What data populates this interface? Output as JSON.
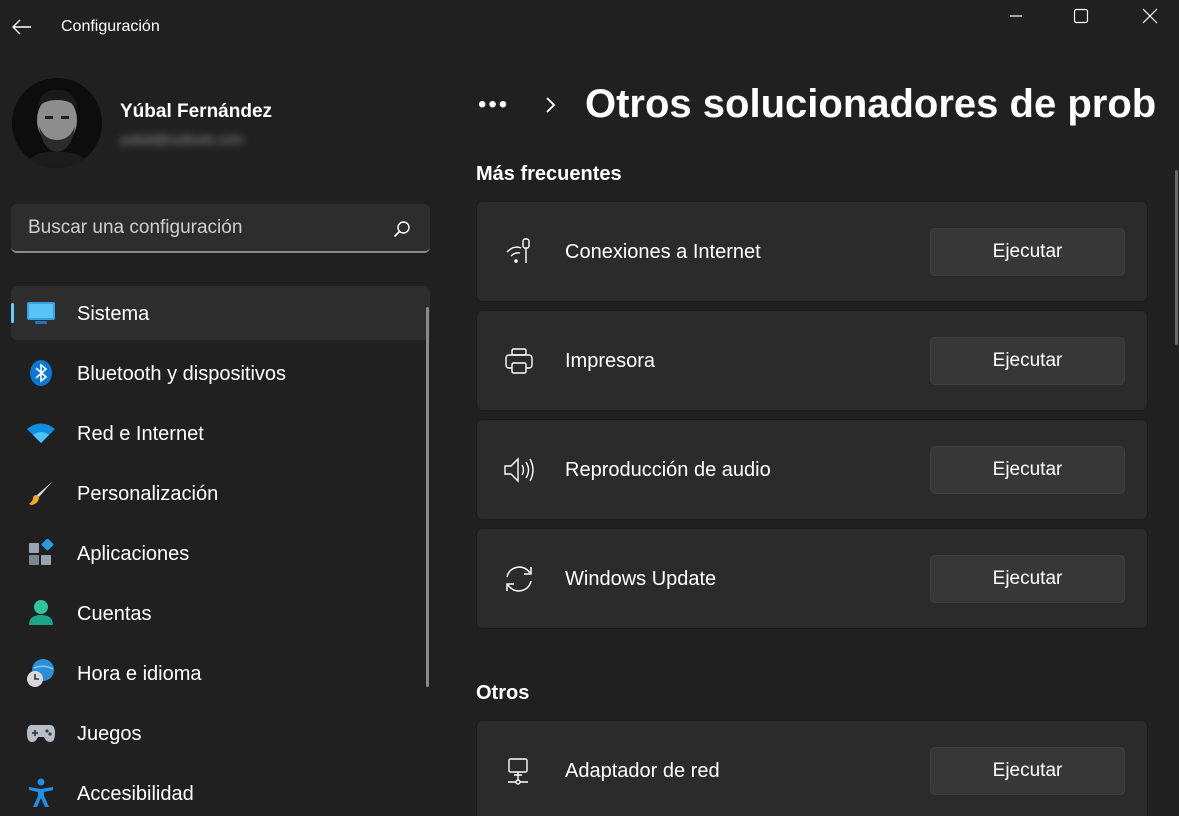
{
  "window": {
    "app_title": "Configuración",
    "controls": {
      "minimize": "minimize-icon",
      "maximize": "maximize-icon",
      "close": "close-icon"
    }
  },
  "profile": {
    "name": "Yúbal Fernández",
    "email": "yubal@outlook.com"
  },
  "search": {
    "placeholder": "Buscar una configuración",
    "icon": "search-icon"
  },
  "sidebar": {
    "items": [
      {
        "label": "Sistema",
        "icon": "system-icon",
        "active": true
      },
      {
        "label": "Bluetooth y dispositivos",
        "icon": "bluetooth-icon",
        "active": false
      },
      {
        "label": "Red e Internet",
        "icon": "wifi-icon",
        "active": false
      },
      {
        "label": "Personalización",
        "icon": "brush-icon",
        "active": false
      },
      {
        "label": "Aplicaciones",
        "icon": "apps-icon",
        "active": false
      },
      {
        "label": "Cuentas",
        "icon": "account-icon",
        "active": false
      },
      {
        "label": "Hora e idioma",
        "icon": "time-language-icon",
        "active": false
      },
      {
        "label": "Juegos",
        "icon": "gamepad-icon",
        "active": false
      },
      {
        "label": "Accesibilidad",
        "icon": "accessibility-icon",
        "active": false
      }
    ]
  },
  "main": {
    "breadcrumb_more": "•••",
    "page_title": "Otros solucionadores de prob",
    "sections": [
      {
        "title": "Más frecuentes",
        "items": [
          {
            "label": "Conexiones a Internet",
            "icon": "network-antenna-icon",
            "button": "Ejecutar"
          },
          {
            "label": "Impresora",
            "icon": "printer-icon",
            "button": "Ejecutar"
          },
          {
            "label": "Reproducción de audio",
            "icon": "speaker-icon",
            "button": "Ejecutar"
          },
          {
            "label": "Windows Update",
            "icon": "sync-icon",
            "button": "Ejecutar"
          }
        ]
      },
      {
        "title": "Otros",
        "items": [
          {
            "label": "Adaptador de red",
            "icon": "network-adapter-icon",
            "button": "Ejecutar"
          }
        ]
      }
    ]
  },
  "colors": {
    "background": "#202020",
    "card": "#2b2b2b",
    "accent": "#60cdff",
    "button": "#373737"
  }
}
